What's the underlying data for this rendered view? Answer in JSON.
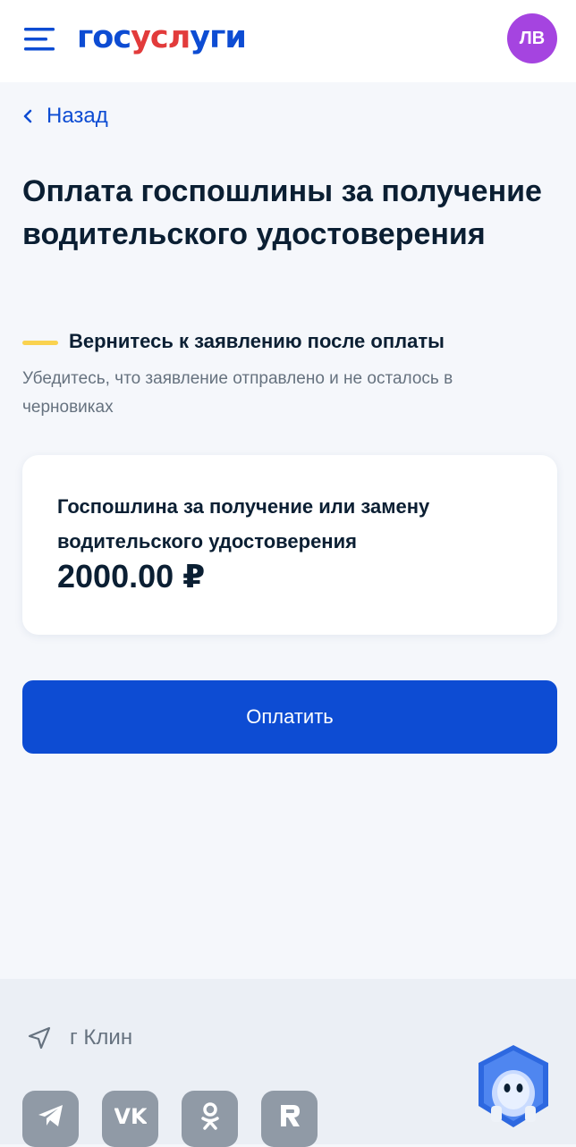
{
  "header": {
    "logo_gos": "гос",
    "logo_usl": "усл",
    "logo_ugi": "уги",
    "avatar_initials": "ЛВ"
  },
  "nav": {
    "back_label": "Назад"
  },
  "page": {
    "title": "Оплата госпошлины за получение водительского удостоверения"
  },
  "notice": {
    "title": "Вернитесь к заявлению после оплаты",
    "text": "Убедитесь, что заявление отправлено и не осталось в черновиках"
  },
  "card": {
    "title": "Госпошлина за получение или замену водительского удостоверения",
    "amount": "2000.00 ₽"
  },
  "actions": {
    "pay_label": "Оплатить"
  },
  "footer": {
    "location": "г Клин",
    "socials": [
      "telegram-icon",
      "vk-icon",
      "odnoklassniki-icon",
      "rutube-icon"
    ]
  },
  "colors": {
    "brand_blue": "#0d4cd3",
    "brand_red": "#e23b3b",
    "avatar": "#a544e0",
    "notice_accent": "#fad24f"
  }
}
